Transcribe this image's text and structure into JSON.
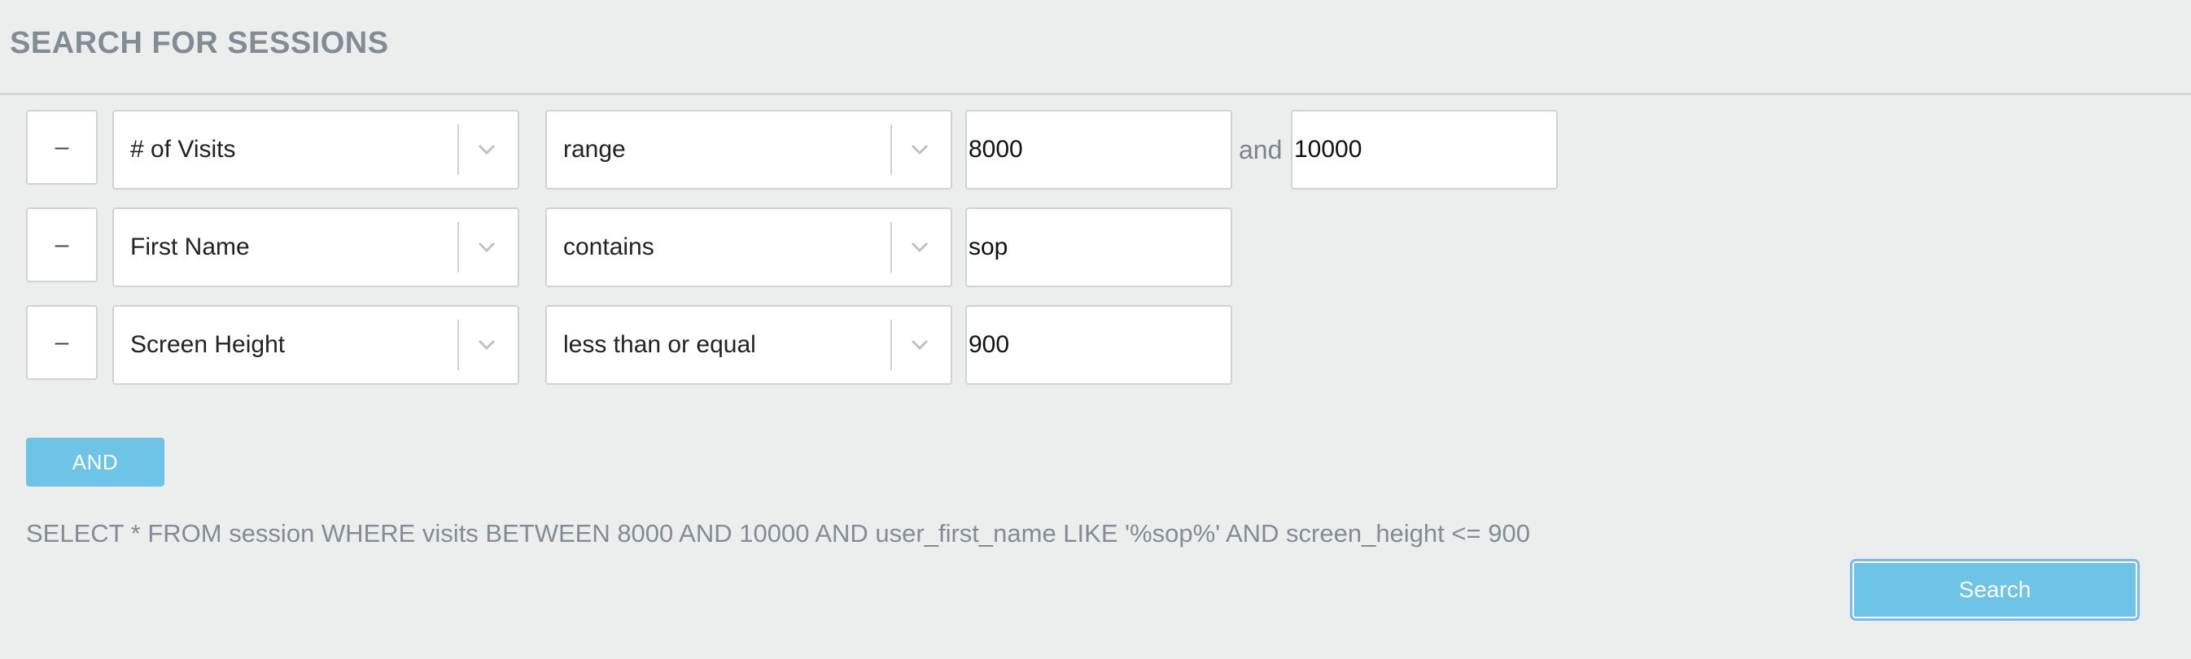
{
  "page": {
    "title": "SEARCH FOR SESSIONS"
  },
  "filters": [
    {
      "remove_label": "–",
      "field": "# of Visits",
      "operator": "range",
      "value": "8000",
      "range_separator": "and",
      "value2": "10000"
    },
    {
      "remove_label": "–",
      "field": "First Name",
      "operator": "contains",
      "value": "sop"
    },
    {
      "remove_label": "–",
      "field": "Screen Height",
      "operator": "less than or equal",
      "value": "900"
    }
  ],
  "and_button": {
    "label": "AND"
  },
  "query_text": "SELECT * FROM session WHERE visits BETWEEN 8000 AND 10000 AND user_first_name LIKE '%sop%' AND screen_height <= 900",
  "search_button": {
    "label": "Search"
  },
  "icons": {
    "select_arrow": "chevron-down-icon"
  },
  "colors": {
    "accent": "#6ec4e6",
    "title": "#838c94",
    "background": "#eceeed"
  }
}
